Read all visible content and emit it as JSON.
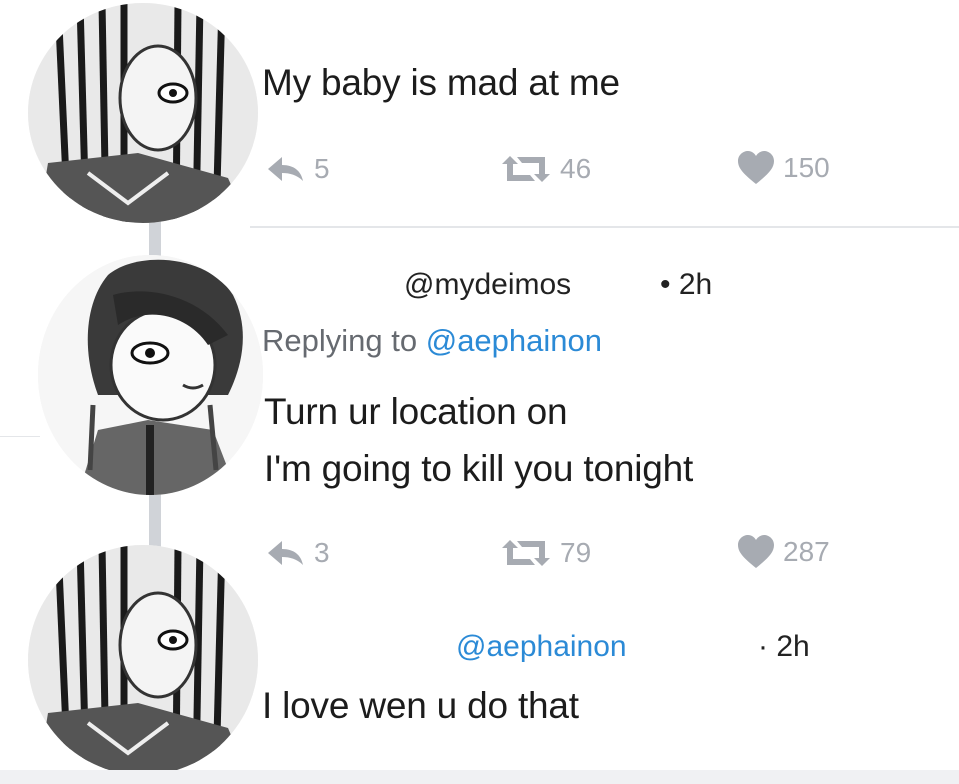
{
  "tweets": [
    {
      "text": "My baby is mad at me",
      "stats": {
        "replies": "5",
        "retweets": "46",
        "likes": "150"
      }
    },
    {
      "handle": "@mydeimos",
      "time": "• 2h",
      "replying_label": "Replying to",
      "replying_to": "@aephainon",
      "text_line1": "Turn ur location on",
      "text_line2": "I'm going to kill you tonight",
      "stats": {
        "replies": "3",
        "retweets": "79",
        "likes": "287"
      }
    },
    {
      "handle": "@aephainon",
      "time": "· 2h",
      "text": "I love wen u do that"
    }
  ],
  "colors": {
    "mention": "#2b8ad6",
    "action_gray": "#a7abb2",
    "thread_line": "#d0d3d8"
  },
  "icons": [
    "reply-icon",
    "retweet-icon",
    "heart-icon"
  ]
}
